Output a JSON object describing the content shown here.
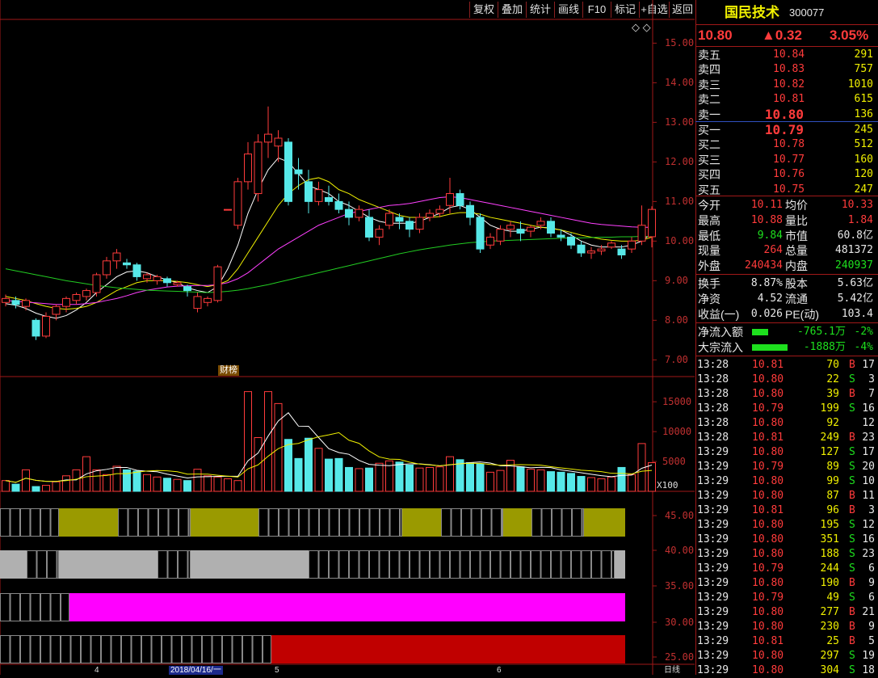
{
  "toolbar": {
    "buttons": [
      "复权",
      "叠加",
      "统计",
      "画线",
      "F10",
      "标记",
      "+自选",
      "返回"
    ]
  },
  "main_chart": {
    "price_ticks": [
      "15.00",
      "14.00",
      "13.00",
      "12.00",
      "11.00",
      "10.00",
      "9.00",
      "8.00",
      "7.00"
    ],
    "marker_label": "财榜",
    "diamond_icons": "◇ ◇"
  },
  "volume_chart": {
    "ticks": [
      "15000",
      "10000",
      "5000"
    ],
    "unit": "X100"
  },
  "indicator_chart": {
    "ticks": [
      "45.00",
      "40.00",
      "35.00",
      "30.00",
      "25.00"
    ]
  },
  "bottom_axis": {
    "labels": [
      "4",
      "2018/04/16/一",
      "5",
      "6"
    ],
    "period": "日线"
  },
  "stock": {
    "name": "国民技术",
    "code": "300077",
    "price": "10.80",
    "change": "▲0.32",
    "change_pct": "3.05%"
  },
  "order_book": {
    "asks": [
      {
        "label": "卖五",
        "price": "10.84",
        "vol": "291"
      },
      {
        "label": "卖四",
        "price": "10.83",
        "vol": "757"
      },
      {
        "label": "卖三",
        "price": "10.82",
        "vol": "1010"
      },
      {
        "label": "卖二",
        "price": "10.81",
        "vol": "615"
      },
      {
        "label": "卖一",
        "price": "10.80",
        "vol": "136"
      }
    ],
    "bids": [
      {
        "label": "买一",
        "price": "10.79",
        "vol": "245"
      },
      {
        "label": "买二",
        "price": "10.78",
        "vol": "512"
      },
      {
        "label": "买三",
        "price": "10.77",
        "vol": "160"
      },
      {
        "label": "买四",
        "price": "10.76",
        "vol": "120"
      },
      {
        "label": "买五",
        "price": "10.75",
        "vol": "247"
      }
    ]
  },
  "stats": [
    {
      "l1": "今开",
      "v1": "10.11",
      "c1": "red",
      "l2": "均价",
      "v2": "10.33",
      "c2": "red"
    },
    {
      "l1": "最高",
      "v1": "10.88",
      "c1": "red",
      "l2": "量比",
      "v2": "1.84",
      "c2": "red"
    },
    {
      "l1": "最低",
      "v1": "9.84",
      "c1": "green",
      "l2": "市值",
      "v2": "60.8亿",
      "c2": "white"
    },
    {
      "l1": "现量",
      "v1": "264",
      "c1": "red",
      "l2": "总量",
      "v2": "481372",
      "c2": "white"
    },
    {
      "l1": "外盘",
      "v1": "240434",
      "c1": "red",
      "l2": "内盘",
      "v2": "240937",
      "c2": "green"
    }
  ],
  "fundamentals": [
    {
      "l1": "换手",
      "v1": "8.87%",
      "l2": "股本",
      "v2": "5.63亿"
    },
    {
      "l1": "净资",
      "v1": "4.52",
      "l2": "流通",
      "v2": "5.42亿"
    },
    {
      "l1": "收益(一)",
      "v1": "0.026",
      "l2": "PE(动)",
      "v2": "103.4"
    }
  ],
  "flows": [
    {
      "label": "净流入额",
      "value": "-765.1万",
      "pct": "-2%",
      "bar_frac": 0.45
    },
    {
      "label": "大宗流入",
      "value": "-1888万",
      "pct": "-4%",
      "bar_frac": 1.0
    }
  ],
  "ticks": [
    {
      "t": "13:28",
      "p": "10.81",
      "v": "70",
      "d": "B",
      "n": "17"
    },
    {
      "t": "13:28",
      "p": "10.80",
      "v": "22",
      "d": "S",
      "n": "3"
    },
    {
      "t": "13:28",
      "p": "10.80",
      "v": "39",
      "d": "B",
      "n": "7"
    },
    {
      "t": "13:28",
      "p": "10.79",
      "v": "199",
      "d": "S",
      "n": "16"
    },
    {
      "t": "13:28",
      "p": "10.80",
      "v": "92",
      "d": "",
      "n": "12"
    },
    {
      "t": "13:28",
      "p": "10.81",
      "v": "249",
      "d": "B",
      "n": "23"
    },
    {
      "t": "13:29",
      "p": "10.80",
      "v": "127",
      "d": "S",
      "n": "17"
    },
    {
      "t": "13:29",
      "p": "10.79",
      "v": "89",
      "d": "S",
      "n": "20"
    },
    {
      "t": "13:29",
      "p": "10.80",
      "v": "99",
      "d": "S",
      "n": "10"
    },
    {
      "t": "13:29",
      "p": "10.80",
      "v": "87",
      "d": "B",
      "n": "11"
    },
    {
      "t": "13:29",
      "p": "10.81",
      "v": "96",
      "d": "B",
      "n": "3"
    },
    {
      "t": "13:29",
      "p": "10.80",
      "v": "195",
      "d": "S",
      "n": "12"
    },
    {
      "t": "13:29",
      "p": "10.80",
      "v": "351",
      "d": "S",
      "n": "16"
    },
    {
      "t": "13:29",
      "p": "10.80",
      "v": "188",
      "d": "S",
      "n": "23"
    },
    {
      "t": "13:29",
      "p": "10.79",
      "v": "244",
      "d": "S",
      "n": "6"
    },
    {
      "t": "13:29",
      "p": "10.80",
      "v": "190",
      "d": "B",
      "n": "9"
    },
    {
      "t": "13:29",
      "p": "10.79",
      "v": "49",
      "d": "S",
      "n": "6"
    },
    {
      "t": "13:29",
      "p": "10.80",
      "v": "277",
      "d": "B",
      "n": "21"
    },
    {
      "t": "13:29",
      "p": "10.80",
      "v": "230",
      "d": "B",
      "n": "9"
    },
    {
      "t": "13:29",
      "p": "10.81",
      "v": "25",
      "d": "B",
      "n": "5"
    },
    {
      "t": "13:29",
      "p": "10.80",
      "v": "297",
      "d": "S",
      "n": "19"
    },
    {
      "t": "13:29",
      "p": "10.80",
      "v": "304",
      "d": "S",
      "n": "18"
    }
  ],
  "colors": {
    "up": "#ff3b3b",
    "down": "#56e8e8",
    "frame": "#a01818",
    "ma5": "#ffffff",
    "ma10": "#f0f000",
    "ma20": "#ff40ff",
    "ma60": "#22cc22",
    "band1": "#9a9a00",
    "band2": "#b0b0b0",
    "band3": "#ff00ff",
    "band4": "#c00000"
  },
  "chart_data": {
    "type": "candlestick",
    "price_range": [
      6.7,
      15.6
    ],
    "candles": [
      [
        8.45,
        8.55,
        8.35,
        8.65
      ],
      [
        8.5,
        8.4,
        8.3,
        8.6
      ],
      [
        8.35,
        8.5,
        8.25,
        8.55
      ],
      [
        8.0,
        7.6,
        7.5,
        8.05
      ],
      [
        7.6,
        8.1,
        7.55,
        8.2
      ],
      [
        8.15,
        8.35,
        8.0,
        8.4
      ],
      [
        8.35,
        8.55,
        8.2,
        8.6
      ],
      [
        8.5,
        8.65,
        8.4,
        8.7
      ],
      [
        8.6,
        8.75,
        8.5,
        8.8
      ],
      [
        8.7,
        9.15,
        8.6,
        9.2
      ],
      [
        9.15,
        9.5,
        9.05,
        9.6
      ],
      [
        9.5,
        9.7,
        9.3,
        9.8
      ],
      [
        9.45,
        9.4,
        9.3,
        9.55
      ],
      [
        9.4,
        9.1,
        9.0,
        9.45
      ],
      [
        9.05,
        9.15,
        8.95,
        9.2
      ],
      [
        9.0,
        9.1,
        8.9,
        9.15
      ],
      [
        9.05,
        8.95,
        8.85,
        9.1
      ],
      [
        8.9,
        8.95,
        8.85,
        9.0
      ],
      [
        8.85,
        8.75,
        8.6,
        8.9
      ],
      [
        8.3,
        8.6,
        8.2,
        8.7
      ],
      [
        8.45,
        8.55,
        8.35,
        8.6
      ],
      [
        8.5,
        9.35,
        8.45,
        9.4
      ],
      [
        10.8,
        10.8,
        10.8,
        10.8
      ],
      [
        10.4,
        11.5,
        10.3,
        11.6
      ],
      [
        11.5,
        12.2,
        11.3,
        12.5
      ],
      [
        11.2,
        12.5,
        11.0,
        12.7
      ],
      [
        12.5,
        12.7,
        12.1,
        13.4
      ],
      [
        12.4,
        12.6,
        12.0,
        12.8
      ],
      [
        12.5,
        11.0,
        10.9,
        12.6
      ],
      [
        11.8,
        11.7,
        11.3,
        12.1
      ],
      [
        11.5,
        11.0,
        10.7,
        11.8
      ],
      [
        11.0,
        11.3,
        10.9,
        11.5
      ],
      [
        11.1,
        11.0,
        10.9,
        11.4
      ],
      [
        11.0,
        10.8,
        10.7,
        11.2
      ],
      [
        10.8,
        10.6,
        10.4,
        11.0
      ],
      [
        10.6,
        10.8,
        10.5,
        10.9
      ],
      [
        10.6,
        10.1,
        10.0,
        10.8
      ],
      [
        10.1,
        10.3,
        9.9,
        10.4
      ],
      [
        10.4,
        10.7,
        10.3,
        10.8
      ],
      [
        10.6,
        10.5,
        10.3,
        10.7
      ],
      [
        10.5,
        10.3,
        10.1,
        10.6
      ],
      [
        10.3,
        10.6,
        10.2,
        10.7
      ],
      [
        10.6,
        10.7,
        10.5,
        10.8
      ],
      [
        10.7,
        10.8,
        10.6,
        10.9
      ],
      [
        10.9,
        11.2,
        10.7,
        11.6
      ],
      [
        11.2,
        10.9,
        10.8,
        11.3
      ],
      [
        10.9,
        10.6,
        10.4,
        11.0
      ],
      [
        10.6,
        9.8,
        9.7,
        10.7
      ],
      [
        9.9,
        10.1,
        9.8,
        10.2
      ],
      [
        10.0,
        10.3,
        9.9,
        10.4
      ],
      [
        10.3,
        10.4,
        10.1,
        10.5
      ],
      [
        10.3,
        10.2,
        10.0,
        10.5
      ],
      [
        10.25,
        10.35,
        10.1,
        10.4
      ],
      [
        10.4,
        10.5,
        10.3,
        10.6
      ],
      [
        10.5,
        10.2,
        10.1,
        10.6
      ],
      [
        10.15,
        10.1,
        10.0,
        10.3
      ],
      [
        10.1,
        9.9,
        9.8,
        10.2
      ],
      [
        9.9,
        9.7,
        9.6,
        10.0
      ],
      [
        9.7,
        9.75,
        9.55,
        9.85
      ],
      [
        9.75,
        9.8,
        9.65,
        9.9
      ],
      [
        9.85,
        9.95,
        9.8,
        10.0
      ],
      [
        9.8,
        9.65,
        9.55,
        9.9
      ],
      [
        9.8,
        10.0,
        9.7,
        10.1
      ],
      [
        10.0,
        10.4,
        9.9,
        10.9
      ],
      [
        10.11,
        10.8,
        9.84,
        10.88
      ]
    ],
    "volume_range": [
      0,
      18000
    ],
    "volumes": [
      1800,
      1200,
      3600,
      800,
      1000,
      1600,
      2600,
      3600,
      5800,
      3600,
      2800,
      4200,
      3600,
      3400,
      2800,
      2400,
      2200,
      2000,
      1800,
      3700,
      2600,
      2400,
      2100,
      1800,
      16700,
      9000,
      16700,
      14700,
      8700,
      5500,
      8900,
      7200,
      5400,
      5500,
      4000,
      3800,
      3900,
      4700,
      5100,
      4900,
      4400,
      3900,
      4000,
      4100,
      5800,
      5300,
      4800,
      4600,
      3200,
      3500,
      5200,
      4100,
      3700,
      3600,
      3300,
      3200,
      3000,
      2500,
      2300,
      2100,
      2400,
      4000,
      2800,
      8000,
      4800
    ],
    "ma_lines": {
      "ma5": [
        8.42,
        8.38,
        8.3,
        8.18,
        8.1,
        8.05,
        8.12,
        8.26,
        8.45,
        8.7,
        8.9,
        9.1,
        9.22,
        9.25,
        9.2,
        9.1,
        9.02,
        8.95,
        8.82,
        8.75,
        8.7,
        8.85,
        9.3,
        9.9,
        10.7,
        11.3,
        11.8,
        12.1,
        12.0,
        11.7,
        11.4,
        11.3,
        11.2,
        11.0,
        10.9,
        10.75,
        10.6,
        10.5,
        10.45,
        10.45,
        10.45,
        10.5,
        10.6,
        10.7,
        10.85,
        10.9,
        10.8,
        10.6,
        10.4,
        10.3,
        10.25,
        10.25,
        10.3,
        10.35,
        10.33,
        10.28,
        10.15,
        10.0,
        9.9,
        9.85,
        9.85,
        9.85,
        9.9,
        10.0,
        10.2
      ],
      "ma10": [
        8.6,
        8.55,
        8.5,
        8.42,
        8.35,
        8.3,
        8.28,
        8.3,
        8.35,
        8.45,
        8.6,
        8.75,
        8.85,
        8.95,
        9.0,
        9.0,
        9.0,
        8.98,
        8.95,
        8.9,
        8.85,
        8.9,
        9.0,
        9.3,
        9.7,
        10.1,
        10.5,
        10.9,
        11.2,
        11.4,
        11.55,
        11.6,
        11.5,
        11.3,
        11.2,
        11.05,
        10.95,
        10.85,
        10.75,
        10.65,
        10.6,
        10.6,
        10.6,
        10.62,
        10.68,
        10.72,
        10.72,
        10.68,
        10.6,
        10.55,
        10.5,
        10.45,
        10.4,
        10.35,
        10.32,
        10.28,
        10.22,
        10.15,
        10.1,
        10.05,
        10.02,
        10.0,
        10.0,
        10.02,
        10.1
      ],
      "ma20": [
        8.5,
        8.48,
        8.46,
        8.44,
        8.42,
        8.4,
        8.4,
        8.4,
        8.42,
        8.45,
        8.5,
        8.55,
        8.62,
        8.7,
        8.76,
        8.8,
        8.84,
        8.86,
        8.87,
        8.88,
        8.88,
        8.9,
        8.95,
        9.05,
        9.2,
        9.4,
        9.6,
        9.8,
        9.95,
        10.1,
        10.25,
        10.4,
        10.5,
        10.6,
        10.7,
        10.75,
        10.8,
        10.85,
        10.9,
        10.92,
        10.95,
        11.0,
        11.05,
        11.1,
        11.12,
        11.1,
        11.05,
        11.0,
        10.95,
        10.9,
        10.85,
        10.8,
        10.75,
        10.7,
        10.65,
        10.6,
        10.55,
        10.5,
        10.45,
        10.42,
        10.4,
        10.38,
        10.36,
        10.35,
        10.35
      ],
      "ma60": [
        9.3,
        9.25,
        9.2,
        9.15,
        9.1,
        9.05,
        9.0,
        8.96,
        8.92,
        8.88,
        8.85,
        8.82,
        8.8,
        8.78,
        8.76,
        8.75,
        8.74,
        8.73,
        8.72,
        8.71,
        8.7,
        8.71,
        8.73,
        8.76,
        8.8,
        8.85,
        8.9,
        8.96,
        9.02,
        9.08,
        9.14,
        9.2,
        9.26,
        9.32,
        9.38,
        9.44,
        9.5,
        9.56,
        9.62,
        9.68,
        9.73,
        9.78,
        9.82,
        9.86,
        9.9,
        9.93,
        9.96,
        9.98,
        10.0,
        10.01,
        10.02,
        10.03,
        10.04,
        10.05,
        10.06,
        10.07,
        10.08,
        10.08,
        10.09,
        10.1,
        10.1,
        10.11,
        10.11,
        10.12,
        10.12
      ]
    },
    "bands": [
      {
        "color": "band1",
        "segments": [
          [
            0,
            73,
            0
          ],
          [
            73,
            146,
            1
          ],
          [
            146,
            236,
            0
          ],
          [
            236,
            320,
            1
          ],
          [
            320,
            498,
            0
          ],
          [
            498,
            546,
            1
          ],
          [
            546,
            623,
            0
          ],
          [
            623,
            658,
            1
          ],
          [
            658,
            723,
            0
          ],
          [
            723,
            774,
            1
          ]
        ]
      },
      {
        "color": "band2",
        "segments": [
          [
            0,
            33,
            1
          ],
          [
            33,
            73,
            0
          ],
          [
            73,
            195,
            1
          ],
          [
            195,
            236,
            0
          ],
          [
            236,
            382,
            1
          ],
          [
            382,
            761,
            0
          ],
          [
            761,
            774,
            1
          ]
        ]
      },
      {
        "color": "band3",
        "segments": [
          [
            0,
            86,
            0
          ],
          [
            86,
            774,
            1
          ]
        ]
      },
      {
        "color": "band4",
        "segments": [
          [
            0,
            336,
            0
          ],
          [
            336,
            774,
            1
          ]
        ]
      }
    ]
  }
}
